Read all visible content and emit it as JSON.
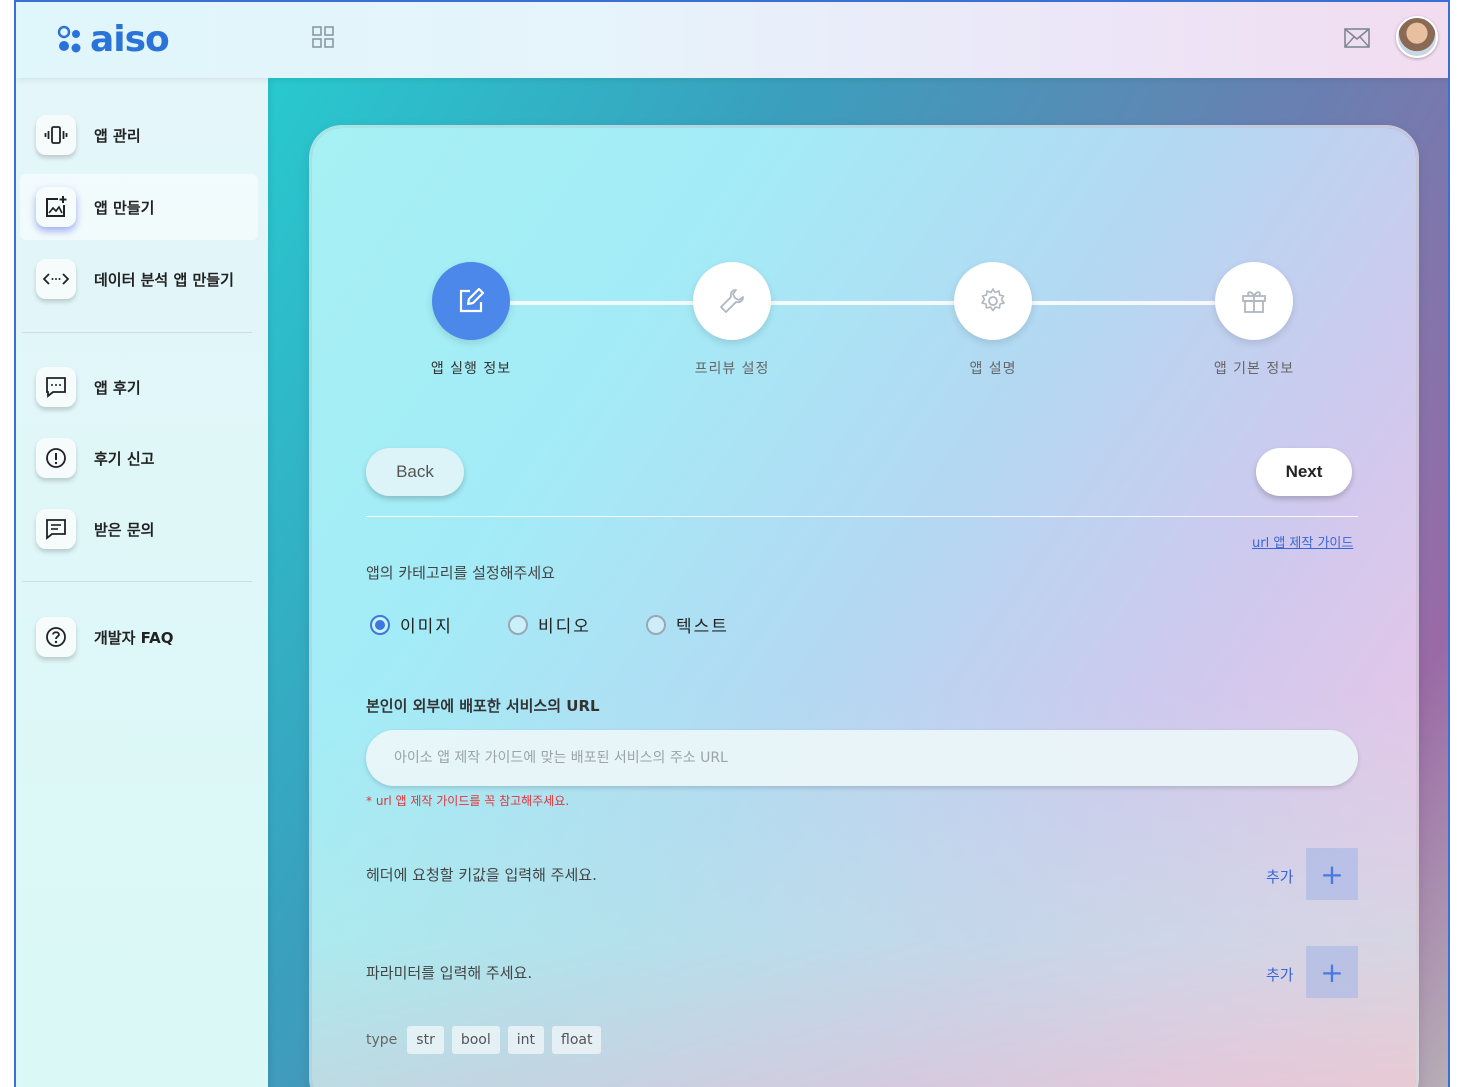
{
  "header": {
    "logo_text": "aiso",
    "grid_icon": "grid-icon",
    "mail_icon": "mail-icon",
    "avatar": "avatar"
  },
  "sidebar": {
    "items": [
      {
        "label": "앱 관리",
        "icon": "vibrate-phone-icon"
      },
      {
        "label": "앱 만들기",
        "icon": "add-image-icon"
      },
      {
        "label": "데이터 분석 앱 만들기",
        "icon": "code-brackets-icon"
      },
      {
        "label": "앱 후기",
        "icon": "chat-bubble-icon"
      },
      {
        "label": "후기 신고",
        "icon": "alert-circle-icon"
      },
      {
        "label": "받은 문의",
        "icon": "message-icon"
      },
      {
        "label": "개발자 FAQ",
        "icon": "help-circle-icon"
      }
    ],
    "active_index": 1
  },
  "stepper": {
    "steps": [
      {
        "label": "앱 실행 정보",
        "icon": "edit-icon",
        "active": true
      },
      {
        "label": "프리뷰 설정",
        "icon": "wrench-icon",
        "active": false
      },
      {
        "label": "앱 설명",
        "icon": "gear-icon",
        "active": false
      },
      {
        "label": "앱 기본 정보",
        "icon": "gift-icon",
        "active": false
      }
    ]
  },
  "nav": {
    "back_label": "Back",
    "next_label": "Next"
  },
  "form": {
    "guide_link": "url 앱 제작 가이드",
    "category_prompt": "앱의 카테고리를 설정해주세요",
    "category_options": [
      "이미지",
      "비디오",
      "텍스트"
    ],
    "category_selected": "이미지",
    "url_label": "본인이 외부에 배포한 서비스의 URL",
    "url_placeholder": "아이소 앱 제작 가이드에 맞는 배포된 서비스의 주소 URL",
    "url_value": "",
    "url_warning": "* url 앱 제작 가이드를 꼭 참고해주세요.",
    "header_prompt": "헤더에 요청할 키값을 입력해 주세요.",
    "param_prompt": "파라미터를 입력해 주세요.",
    "add_label": "추가",
    "add_symbol": "+",
    "type_label": "type",
    "types": [
      "str",
      "bool",
      "int",
      "float"
    ]
  },
  "colors": {
    "accent": "#4c87ea",
    "link": "#3a66d6",
    "warning": "#e0343a"
  }
}
